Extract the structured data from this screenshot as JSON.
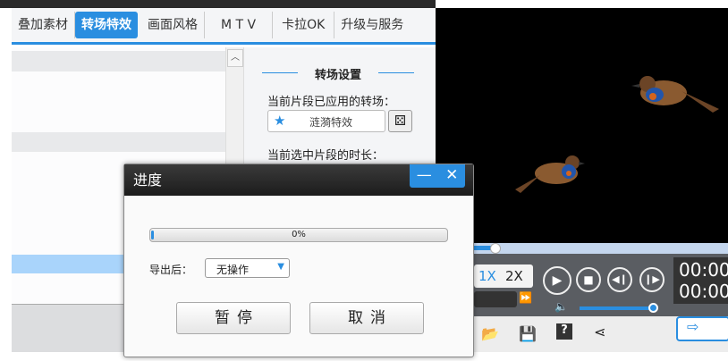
{
  "tabs": [
    "叠加素材",
    "转场特效",
    "画面风格",
    "M T V",
    "卡拉OK",
    "升级与服务"
  ],
  "active_tab": 1,
  "side": {
    "header": "转场设置",
    "applied_label": "当前片段已应用的转场：",
    "applied_value": "涟漪特效",
    "duration_label": "当前选中片段的时长："
  },
  "player": {
    "speed_1x": "1X",
    "speed_2x": "2X",
    "time1": "00:00",
    "time2": "00:00",
    "volume_percent": 100,
    "seek_percent": 8
  },
  "dialog": {
    "title": "进度",
    "progress_text": "0%",
    "progress_percent": 0,
    "after_label": "导出后：",
    "after_value": "无操作",
    "pause": "暂停",
    "cancel": "取消"
  },
  "colors": {
    "accent": "#2a8ee0"
  }
}
